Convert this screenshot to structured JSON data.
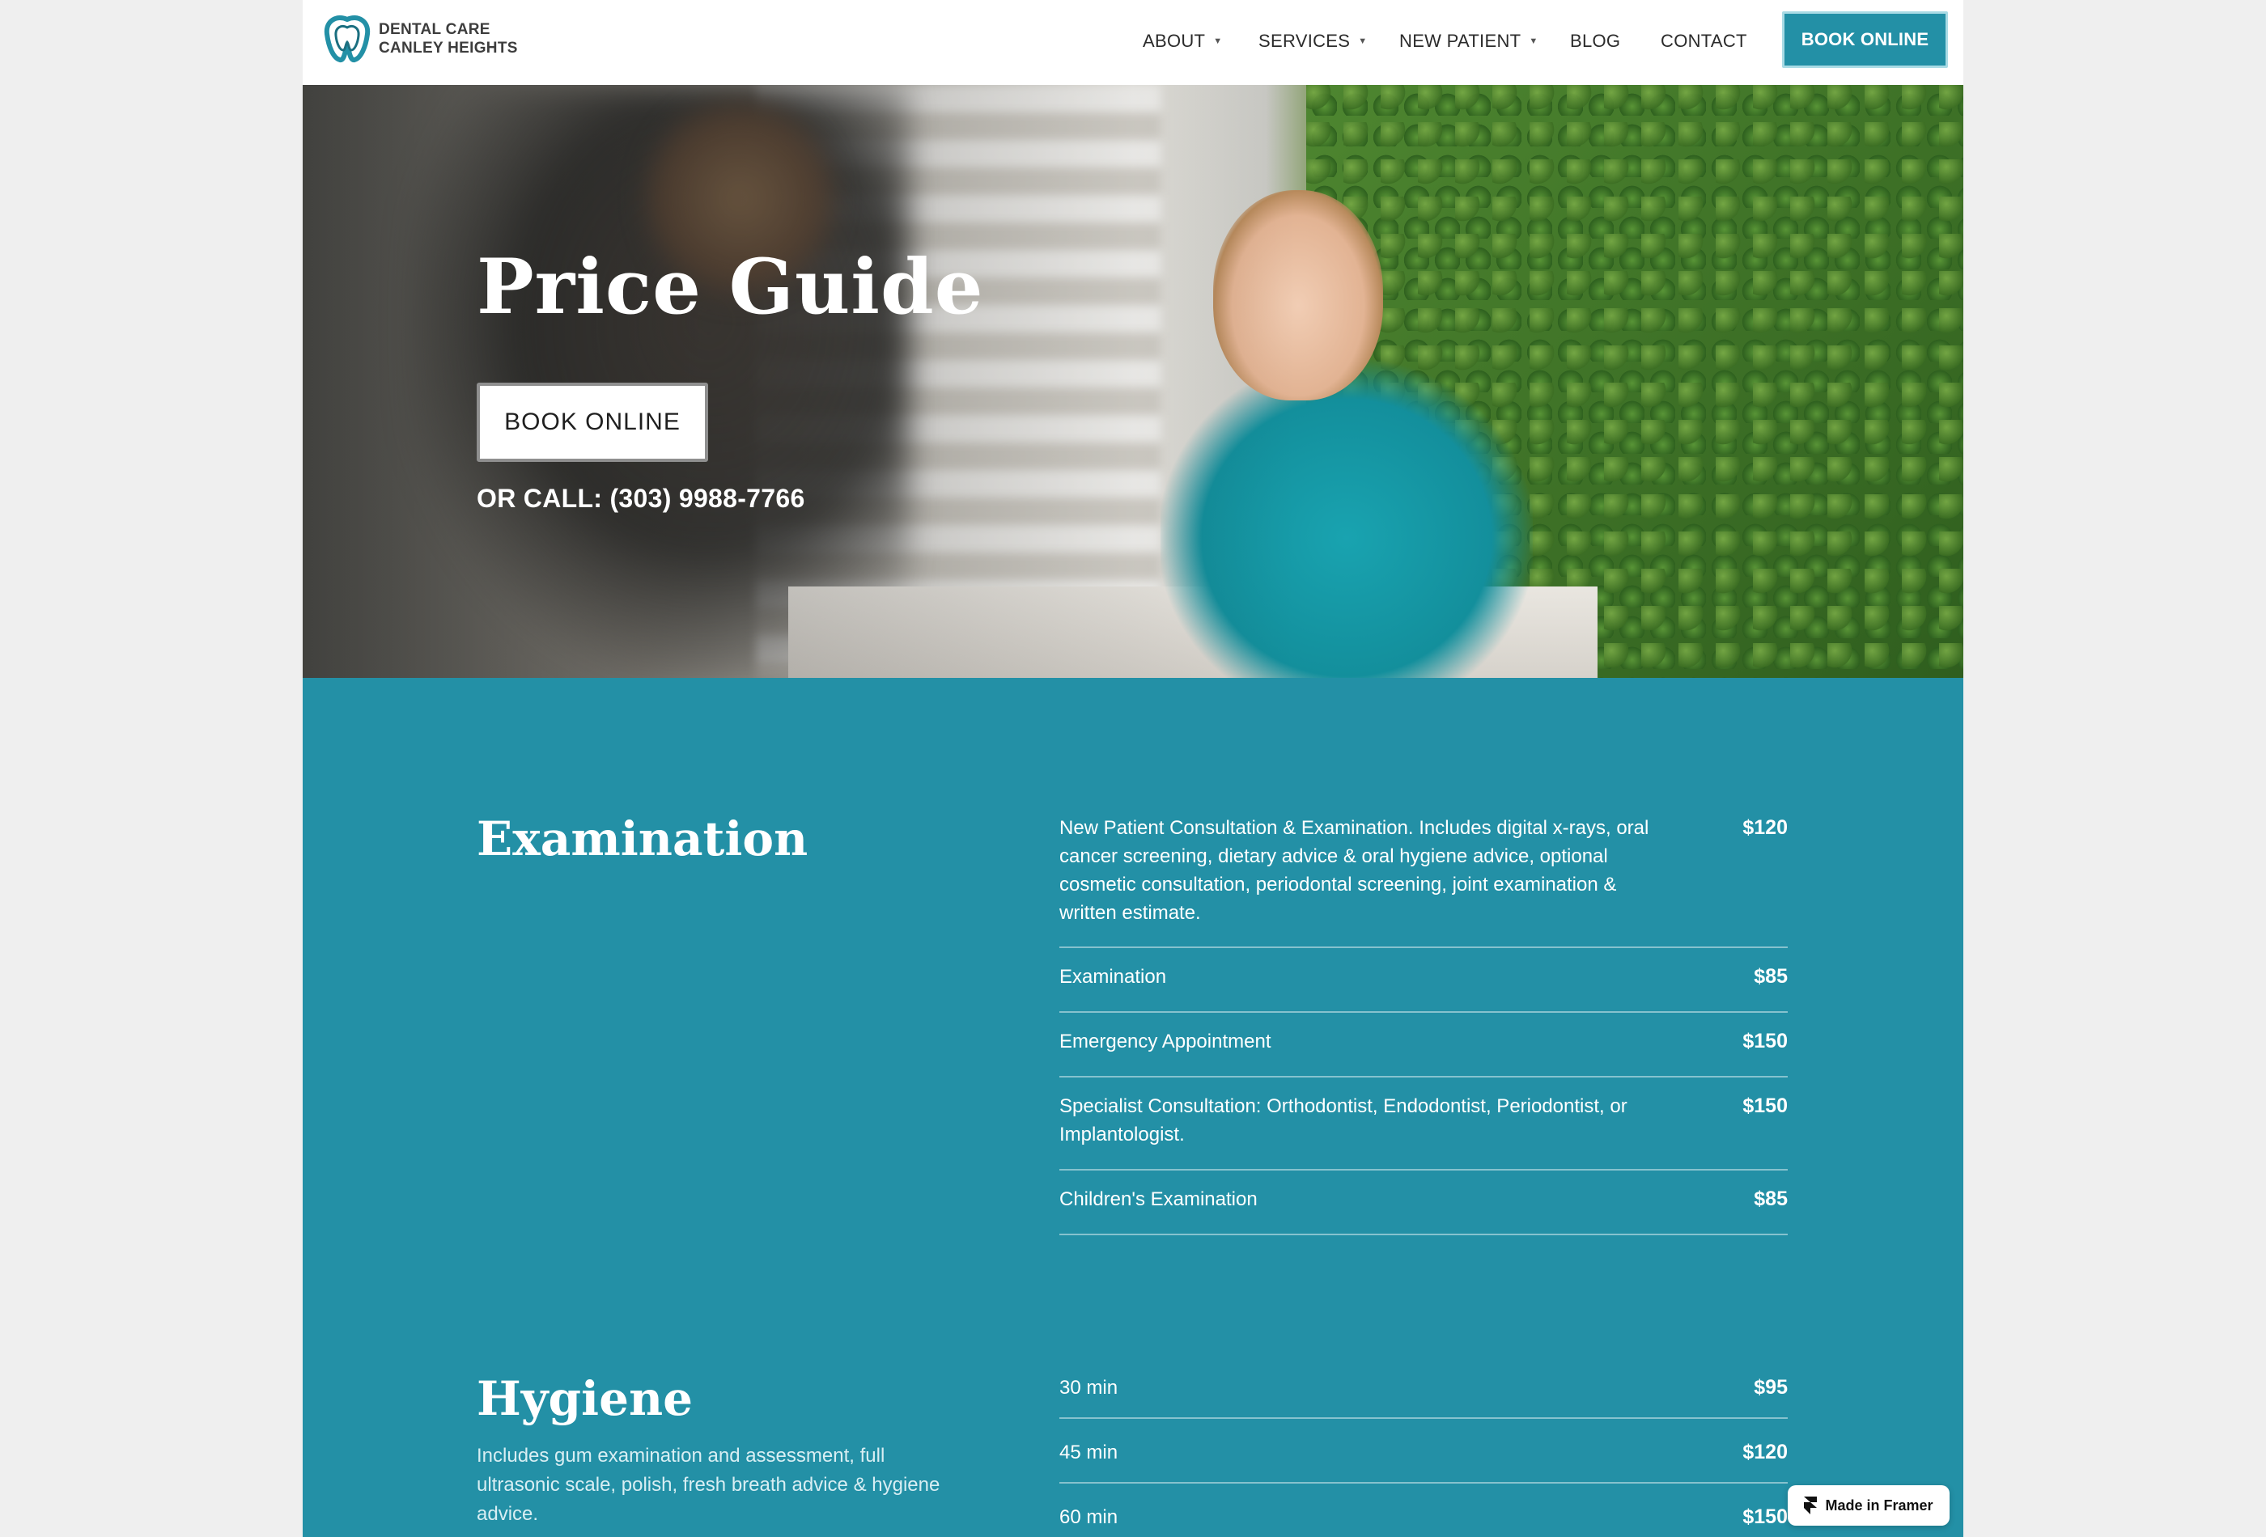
{
  "brand": {
    "line1": "DENTAL CARE",
    "line2": "CANLEY HEIGHTS",
    "logo_icon": "tooth-logo-icon",
    "accent_color": "#2390a6"
  },
  "nav": {
    "items": [
      {
        "label": "ABOUT",
        "has_dropdown": true
      },
      {
        "label": "SERVICES",
        "has_dropdown": true
      },
      {
        "label": "NEW PATIENT",
        "has_dropdown": true
      },
      {
        "label": "BLOG",
        "has_dropdown": false
      },
      {
        "label": "CONTACT",
        "has_dropdown": false
      }
    ],
    "book_label": "BOOK ONLINE"
  },
  "hero": {
    "title": "Price Guide",
    "book_label": "BOOK ONLINE",
    "call_text": "OR CALL: (303) 9988-7766"
  },
  "examination": {
    "title": "Examination",
    "rows": [
      {
        "desc": "New Patient Consultation & Examination. Includes digital x-rays, oral cancer screening, dietary advice & oral hygiene advice, optional cosmetic consultation, periodontal screening, joint examination & written estimate.",
        "price": "$120"
      },
      {
        "desc": "Examination",
        "price": "$85"
      },
      {
        "desc": "Emergency Appointment",
        "price": "$150"
      },
      {
        "desc": "Specialist Consultation: Orthodontist, Endodontist, Periodontist, or Implantologist.",
        "price": "$150"
      },
      {
        "desc": "Children's Examination",
        "price": "$85"
      }
    ]
  },
  "hygiene": {
    "title": "Hygiene",
    "description": "Includes gum examination and assessment, full ultrasonic scale, polish, fresh breath advice & hygiene advice.",
    "rows": [
      {
        "desc": "30 min",
        "price": "$95"
      },
      {
        "desc": "45 min",
        "price": "$120"
      },
      {
        "desc": "60 min",
        "price": "$150"
      }
    ]
  },
  "framer_badge": {
    "label": "Made in Framer",
    "icon": "framer-icon"
  }
}
